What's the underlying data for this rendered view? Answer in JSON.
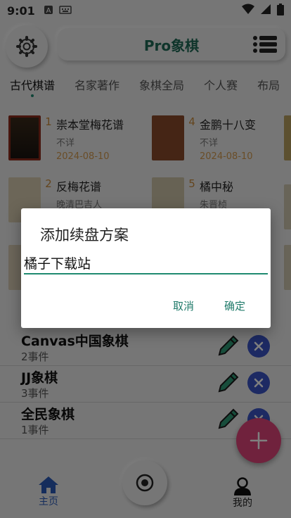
{
  "status_bar": {
    "time": "9:01"
  },
  "header": {
    "title": "Pro象棋"
  },
  "tabs": [
    {
      "label": "古代棋谱"
    },
    {
      "label": "名家著作"
    },
    {
      "label": "象棋全局"
    },
    {
      "label": "个人赛"
    },
    {
      "label": "布局"
    }
  ],
  "books": [
    {
      "num": "1",
      "title": "崇本堂梅花谱",
      "author": "不详",
      "date": "2024-08-10"
    },
    {
      "num": "4",
      "title": "金鹏十八变",
      "author": "不详",
      "date": "2024-08-10"
    },
    {
      "num": "2",
      "title": "反梅花谱",
      "author": "晚清巴吉人",
      "date": ""
    },
    {
      "num": "5",
      "title": "橘中秘",
      "author": "朱晋桢",
      "date": ""
    }
  ],
  "sites": [
    {
      "name": "Canvas中国象棋",
      "count": "2事件"
    },
    {
      "name": "JJ象棋",
      "count": "3事件"
    },
    {
      "name": "全民象棋",
      "count": "1事件"
    }
  ],
  "bottom_nav": {
    "home_label": "主页",
    "me_label": "我的"
  },
  "dialog": {
    "title": "添加续盘方案",
    "input_value": "橘子下载站",
    "cancel_label": "取消",
    "ok_label": "确定"
  },
  "colors": {
    "accent": "#1f8a70",
    "fab": "#e0457a",
    "delete": "#3b55c7",
    "home": "#2a5bb8"
  }
}
